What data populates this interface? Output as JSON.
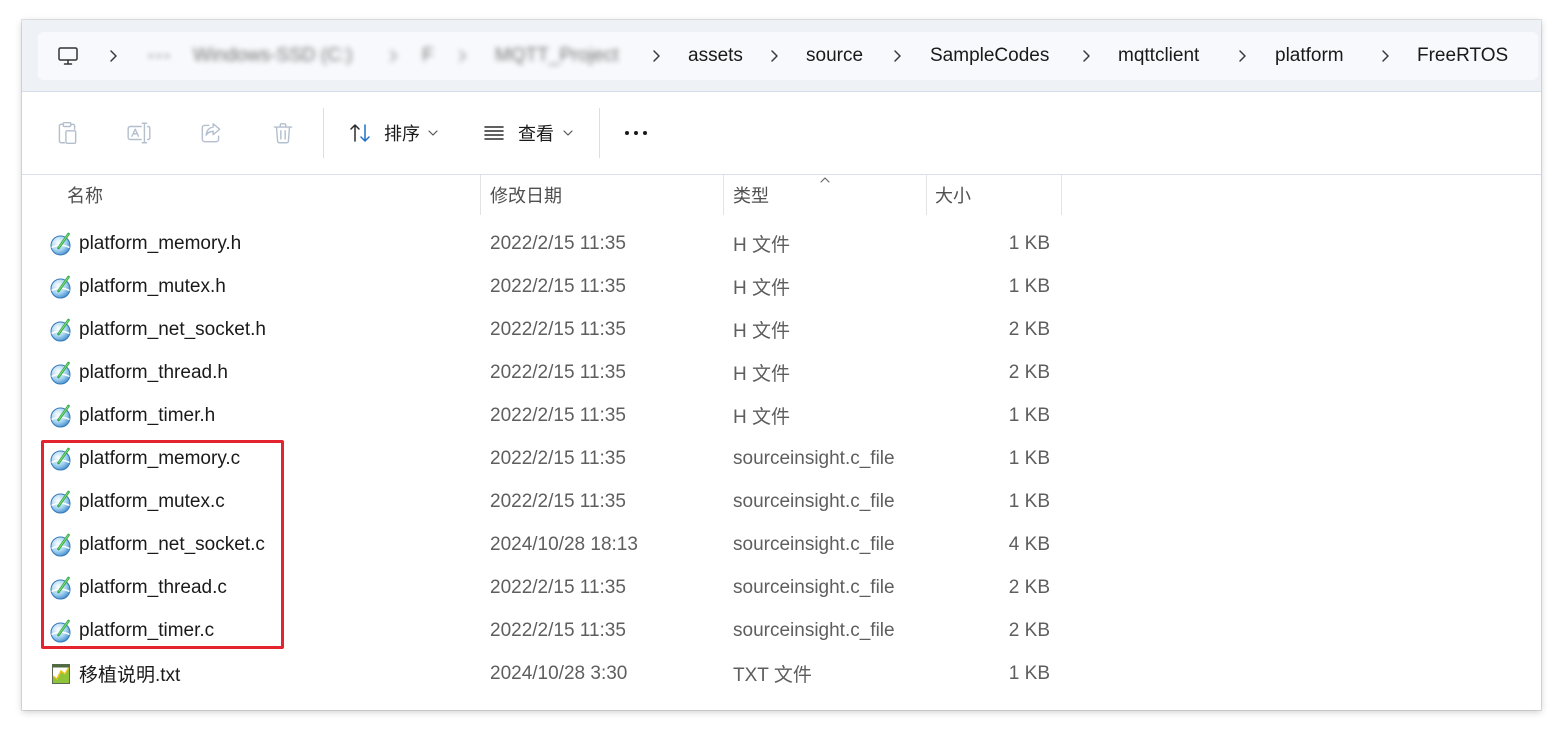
{
  "colors": {
    "highlight": "#e3232d",
    "text_primary": "#1a1a1a",
    "text_secondary": "#5e5e5e",
    "icon_disabled": "#b3bfcd",
    "accent": "#1f6fc5",
    "address_band": "#eef2f7",
    "breadcrumb_box": "#f8f9fc"
  },
  "address_bar": {
    "root_icon": "computer-icon",
    "overflow_icon": "more-horizontal-icon",
    "separator_icon": "chevron-right-icon",
    "crumbs": [
      "Windows-SSD (C:)",
      "F",
      "MQTT_Project",
      "assets",
      "source",
      "SampleCodes",
      "mqttclient",
      "platform",
      "FreeRTOS"
    ]
  },
  "toolbar": {
    "paste_icon": "paste-icon",
    "rename_icon": "rename-icon",
    "share_icon": "share-icon",
    "delete_icon": "delete-icon",
    "sort_icon": "sort-icon",
    "sort_label": "排序",
    "view_icon": "view-list-icon",
    "view_label": "查看",
    "dropdown_icon": "chevron-down-icon",
    "more_icon": "more-icon"
  },
  "columns": {
    "name": "名称",
    "modified": "修改日期",
    "type": "类型",
    "size": "大小",
    "sort_indicator_icon": "sort-ascending-icon"
  },
  "files": [
    {
      "name": "platform_memory.h",
      "modified": "2022/2/15 11:35",
      "type": "H 文件",
      "size": "1 KB",
      "icon": "source-insight-file-icon"
    },
    {
      "name": "platform_mutex.h",
      "modified": "2022/2/15 11:35",
      "type": "H 文件",
      "size": "1 KB",
      "icon": "source-insight-file-icon"
    },
    {
      "name": "platform_net_socket.h",
      "modified": "2022/2/15 11:35",
      "type": "H 文件",
      "size": "2 KB",
      "icon": "source-insight-file-icon"
    },
    {
      "name": "platform_thread.h",
      "modified": "2022/2/15 11:35",
      "type": "H 文件",
      "size": "2 KB",
      "icon": "source-insight-file-icon"
    },
    {
      "name": "platform_timer.h",
      "modified": "2022/2/15 11:35",
      "type": "H 文件",
      "size": "1 KB",
      "icon": "source-insight-file-icon"
    },
    {
      "name": "platform_memory.c",
      "modified": "2022/2/15 11:35",
      "type": "sourceinsight.c_file",
      "size": "1 KB",
      "icon": "source-insight-file-icon"
    },
    {
      "name": "platform_mutex.c",
      "modified": "2022/2/15 11:35",
      "type": "sourceinsight.c_file",
      "size": "1 KB",
      "icon": "source-insight-file-icon"
    },
    {
      "name": "platform_net_socket.c",
      "modified": "2024/10/28 18:13",
      "type": "sourceinsight.c_file",
      "size": "4 KB",
      "icon": "source-insight-file-icon"
    },
    {
      "name": "platform_thread.c",
      "modified": "2022/2/15 11:35",
      "type": "sourceinsight.c_file",
      "size": "2 KB",
      "icon": "source-insight-file-icon"
    },
    {
      "name": "platform_timer.c",
      "modified": "2022/2/15 11:35",
      "type": "sourceinsight.c_file",
      "size": "2 KB",
      "icon": "source-insight-file-icon"
    },
    {
      "name": "移植说明.txt",
      "modified": "2024/10/28 3:30",
      "type": "TXT 文件",
      "size": "1 KB",
      "icon": "text-file-icon"
    }
  ]
}
